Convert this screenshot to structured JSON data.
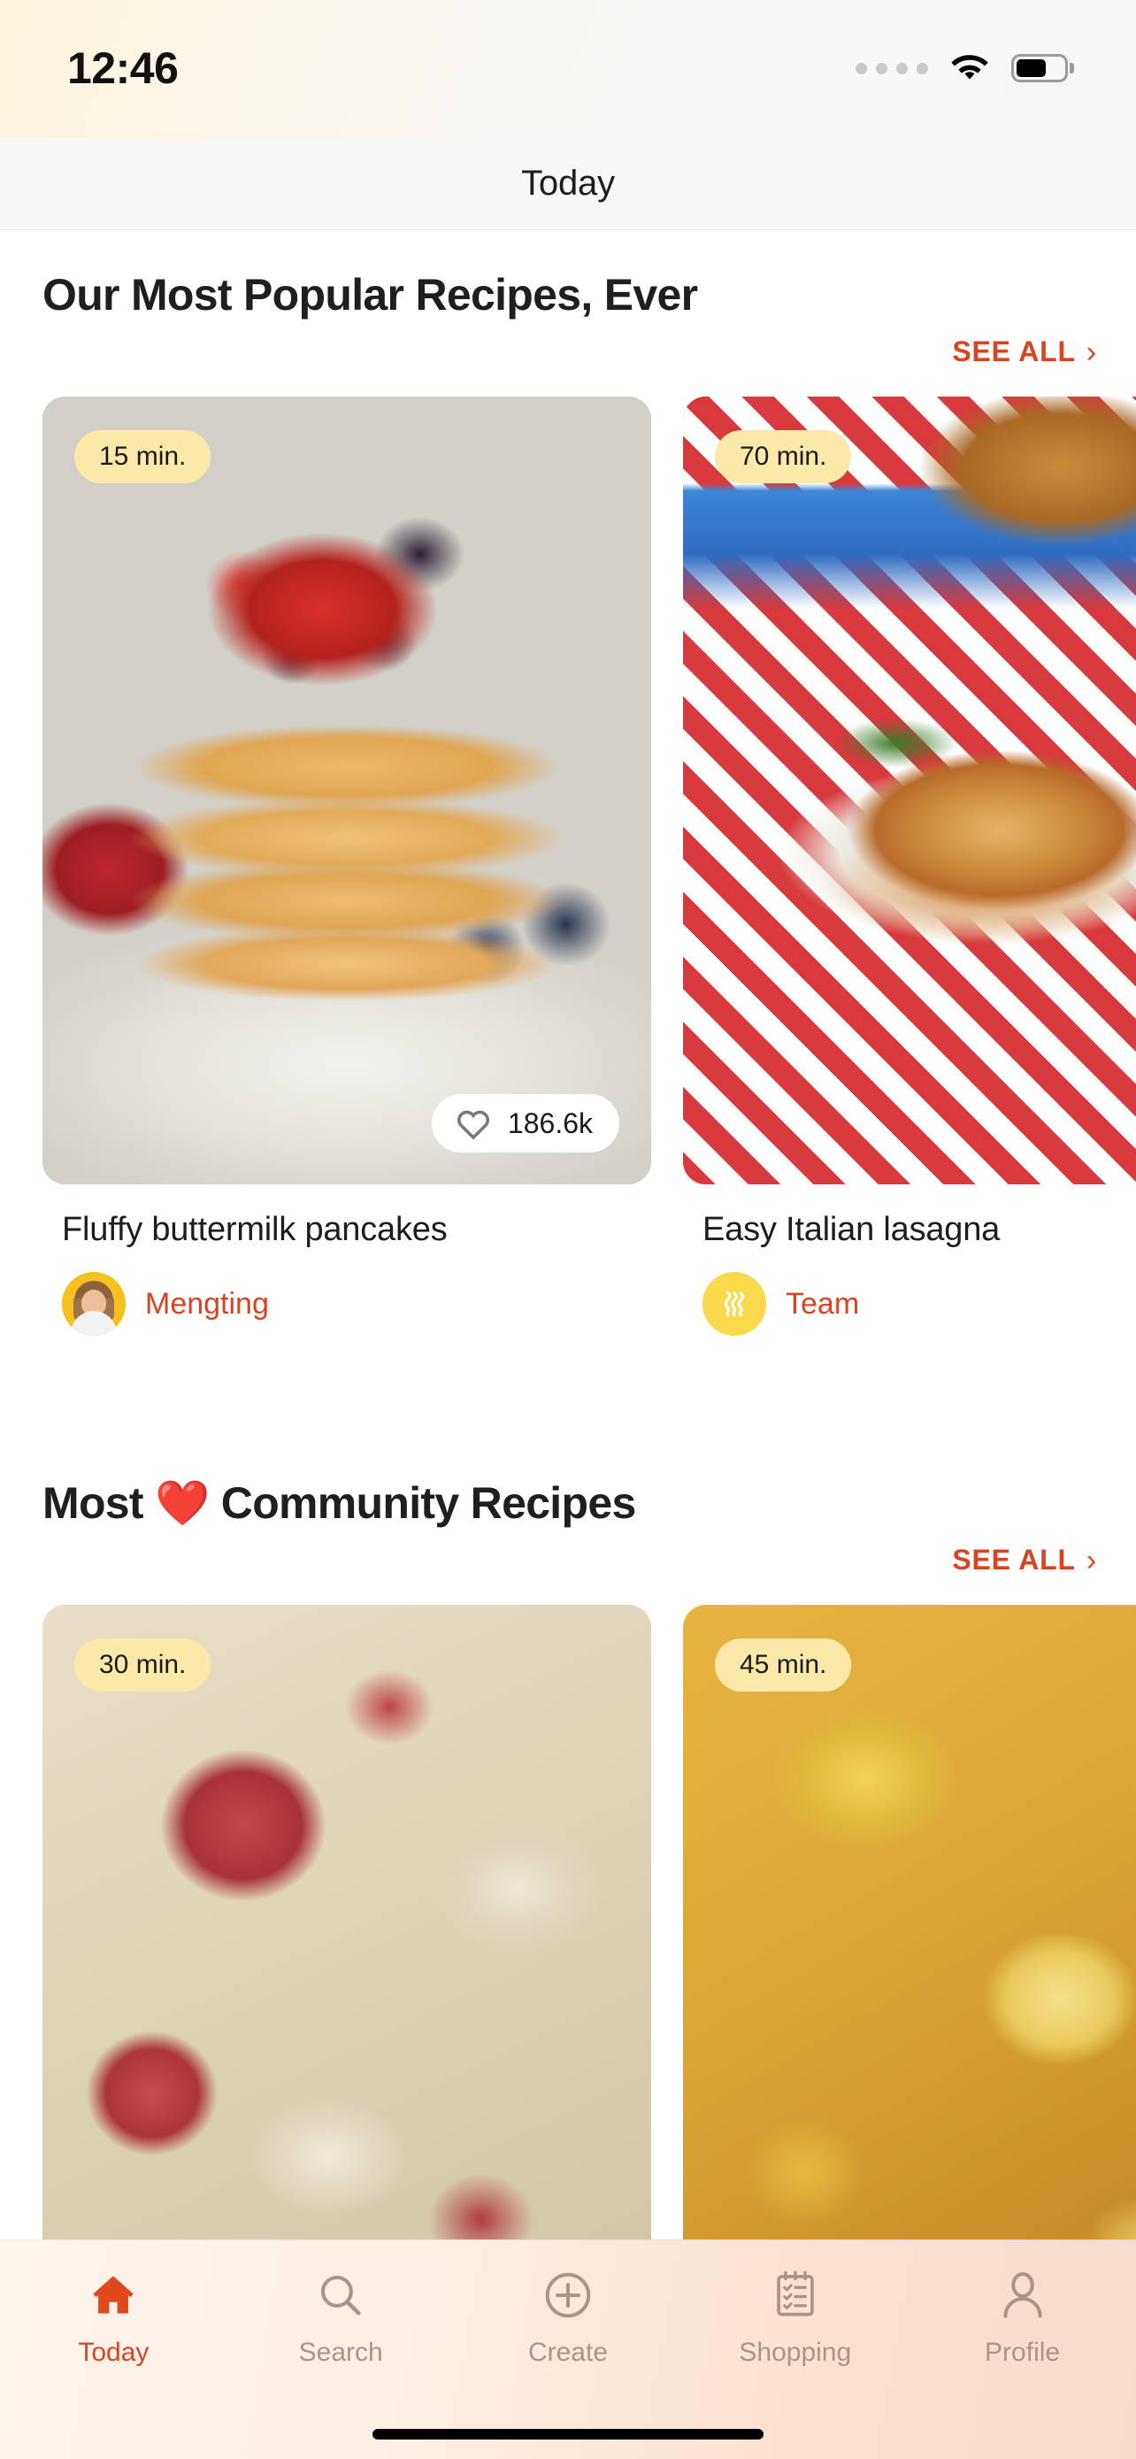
{
  "status_bar": {
    "time": "12:46",
    "signal_icon": "signal-dots-icon",
    "wifi_icon": "wifi-icon",
    "battery_icon": "battery-icon",
    "battery_level_pct": 64
  },
  "nav": {
    "title": "Today"
  },
  "colors": {
    "accent": "#d8441f",
    "badge_bg": "#fae9a8",
    "avatar_yellow": "#fada4d",
    "tab_inactive": "#a89587",
    "nav_bg": "#f8f8f7"
  },
  "sections": [
    {
      "title": "Our Most Popular Recipes, Ever",
      "emoji": "",
      "see_all_label": "SEE ALL",
      "see_all_chevron": "›",
      "cards": [
        {
          "time_badge": "15 min.",
          "likes": "186.6k",
          "likes_visible": true,
          "title": "Fluffy buttermilk pancakes",
          "author": "Mengting",
          "avatar_type": "photo",
          "image_name": "pancakes-with-berries-photo",
          "heart_icon": "heart-outline-icon"
        },
        {
          "time_badge": "70 min.",
          "likes": "",
          "likes_visible": false,
          "title": "Easy Italian lasagna",
          "author": "Team",
          "avatar_type": "steam",
          "image_name": "italian-lasagna-photo",
          "heart_icon": "heart-outline-icon"
        }
      ]
    },
    {
      "title": "Most ❤️ Community Recipes",
      "emoji": "❤️",
      "see_all_label": "SEE ALL",
      "see_all_chevron": "›",
      "cards": [
        {
          "time_badge": "30 min.",
          "likes": "",
          "likes_visible": false,
          "title": "",
          "author": "",
          "avatar_type": "none",
          "image_name": "creamy-pasta-salad-photo",
          "heart_icon": "heart-outline-icon"
        },
        {
          "time_badge": "45 min.",
          "likes": "",
          "likes_visible": false,
          "title": "",
          "author": "",
          "avatar_type": "none",
          "image_name": "baked-macaroni-photo",
          "heart_icon": "heart-outline-icon"
        }
      ]
    }
  ],
  "tab_bar": {
    "items": [
      {
        "label": "Today",
        "icon": "home-icon",
        "active": true
      },
      {
        "label": "Search",
        "icon": "search-icon",
        "active": false
      },
      {
        "label": "Create",
        "icon": "plus-circle-icon",
        "active": false
      },
      {
        "label": "Shopping",
        "icon": "clipboard-list-icon",
        "active": false
      },
      {
        "label": "Profile",
        "icon": "person-icon",
        "active": false
      }
    ]
  }
}
